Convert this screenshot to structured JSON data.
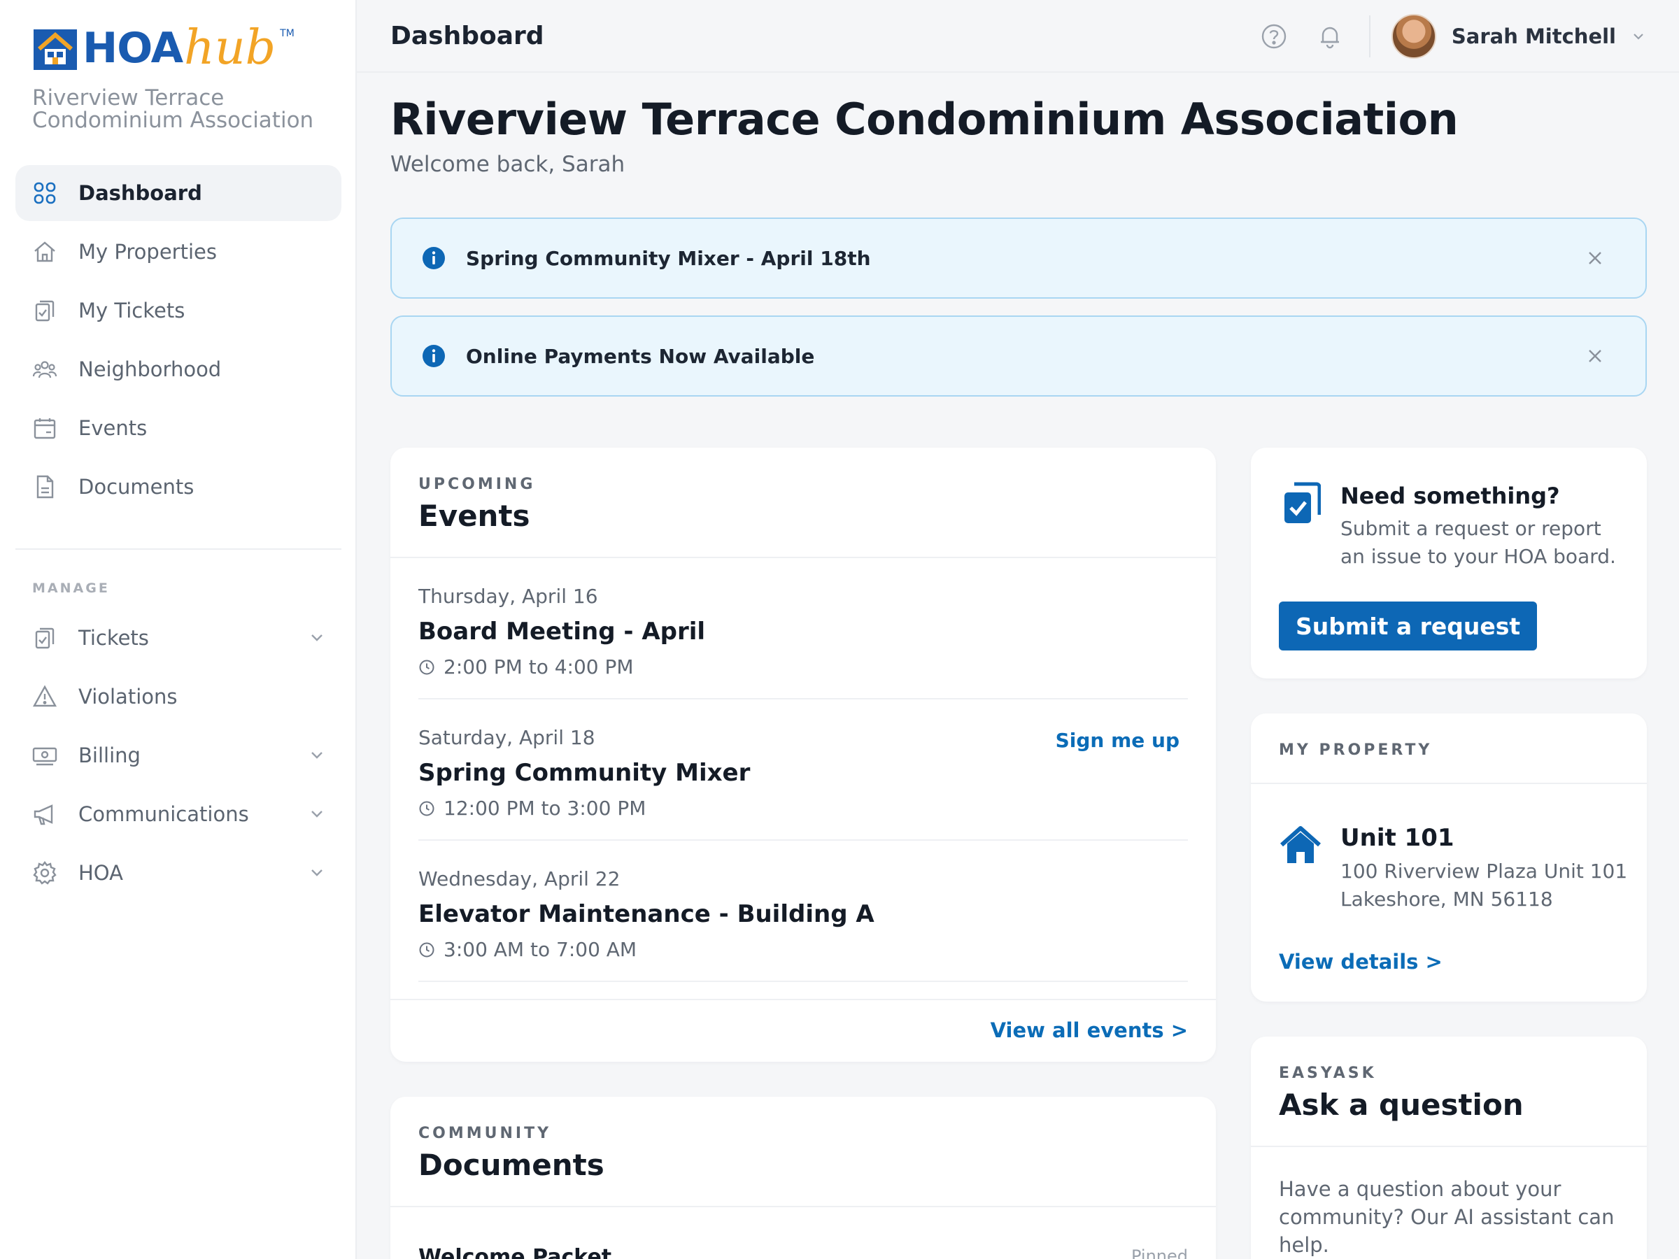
{
  "brand": {
    "logo_text": "HOA",
    "logo_script": "hub",
    "logo_tm": "TM",
    "org_name": "Riverview Terrace Condominium Association"
  },
  "sidebar": {
    "items": [
      {
        "label": "Dashboard",
        "icon": "grid-icon",
        "active": true
      },
      {
        "label": "My Properties",
        "icon": "home-icon"
      },
      {
        "label": "My Tickets",
        "icon": "clipboard-icon"
      },
      {
        "label": "Neighborhood",
        "icon": "people-icon"
      },
      {
        "label": "Events",
        "icon": "calendar-icon"
      },
      {
        "label": "Documents",
        "icon": "document-icon"
      }
    ],
    "manage_label": "MANAGE",
    "manage_items": [
      {
        "label": "Tickets",
        "icon": "clipboard-icon",
        "expandable": true
      },
      {
        "label": "Violations",
        "icon": "warning-icon",
        "expandable": false
      },
      {
        "label": "Billing",
        "icon": "billing-icon",
        "expandable": true
      },
      {
        "label": "Communications",
        "icon": "megaphone-icon",
        "expandable": true
      },
      {
        "label": "HOA",
        "icon": "gear-icon",
        "expandable": true
      }
    ]
  },
  "header": {
    "title": "Dashboard",
    "user_name": "Sarah Mitchell"
  },
  "page": {
    "title": "Riverview Terrace Condominium Association",
    "subtitle": "Welcome back, Sarah"
  },
  "banners": [
    {
      "text": "Spring Community Mixer - April 18th"
    },
    {
      "text": "Online Payments Now Available"
    }
  ],
  "events_card": {
    "eyebrow": "UPCOMING",
    "title": "Events",
    "events": [
      {
        "date": "Thursday, April 16",
        "name": "Board Meeting - April",
        "time": "2:00 PM to 4:00 PM"
      },
      {
        "date": "Saturday, April 18",
        "name": "Spring Community Mixer",
        "time": "12:00 PM to 3:00 PM",
        "action": "Sign me up"
      },
      {
        "date": "Wednesday, April 22",
        "name": "Elevator Maintenance - Building A",
        "time": "3:00 AM to 7:00 AM"
      }
    ],
    "view_all": "View all events >"
  },
  "need_card": {
    "title": "Need something?",
    "description": "Submit a request or report an issue to your HOA board.",
    "button": "Submit a request"
  },
  "property_card": {
    "eyebrow": "MY PROPERTY",
    "unit": "Unit 101",
    "address_line1": "100 Riverview Plaza Unit 101",
    "address_line2": "Lakeshore, MN 56118",
    "link": "View details >"
  },
  "documents_card": {
    "eyebrow": "COMMUNITY",
    "title": "Documents",
    "first_doc": "Welcome Packet",
    "first_doc_tag": "Pinned"
  },
  "ask_card": {
    "eyebrow": "EASYASK",
    "title": "Ask a question",
    "body": "Have a question about your community? Our AI assistant can help."
  },
  "colors": {
    "accent": "#0d67b5",
    "link": "#0b6cb7",
    "banner_bg": "#eaf6fd",
    "banner_border": "#a9d6f2",
    "logo_blue": "#1a5bb0",
    "logo_orange": "#f2a426"
  }
}
